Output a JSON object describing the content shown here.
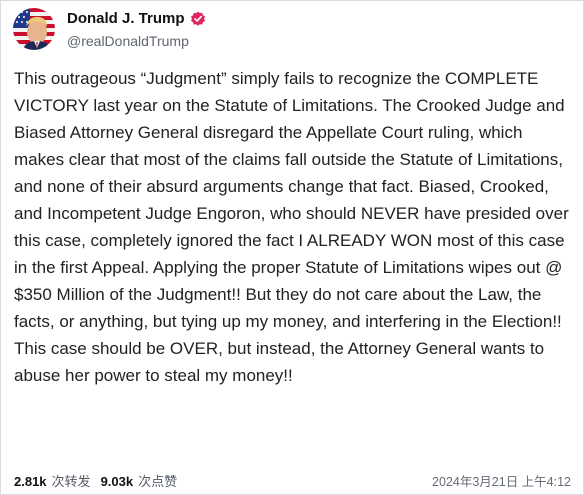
{
  "author": {
    "display_name": "Donald J. Trump",
    "handle": "@realDonaldTrump",
    "verified": true,
    "avatar_icon": "profile-photo-flag-background",
    "verified_badge_color": "#e0245e"
  },
  "post": {
    "text": "This outrageous “Judgment” simply fails to recognize the COMPLETE VICTORY last year on the Statute of Limitations. The Crooked Judge and Biased Attorney General disregard the Appellate Court ruling, which makes clear that most of the claims fall outside the Statute of Limitations, and none of their absurd arguments change that fact. Biased, Crooked, and Incompetent Judge Engoron, who should NEVER have presided over this case, completely ignored the fact I ALREADY WON most of this case in the first Appeal. Applying the proper Statute of Limitations wipes out @ $350 Million of the Judgment!! But they do not care about the Law, the facts, or anything, but tying up my money, and interfering in the Election!! This case should be OVER, but instead, the Attorney General wants to abuse her power to steal my money!!"
  },
  "stats": {
    "reposts_count": "2.81k",
    "reposts_label": "次转发",
    "likes_count": "9.03k",
    "likes_label": "次点赞",
    "timestamp": "2024年3月21日 上午4:12"
  }
}
